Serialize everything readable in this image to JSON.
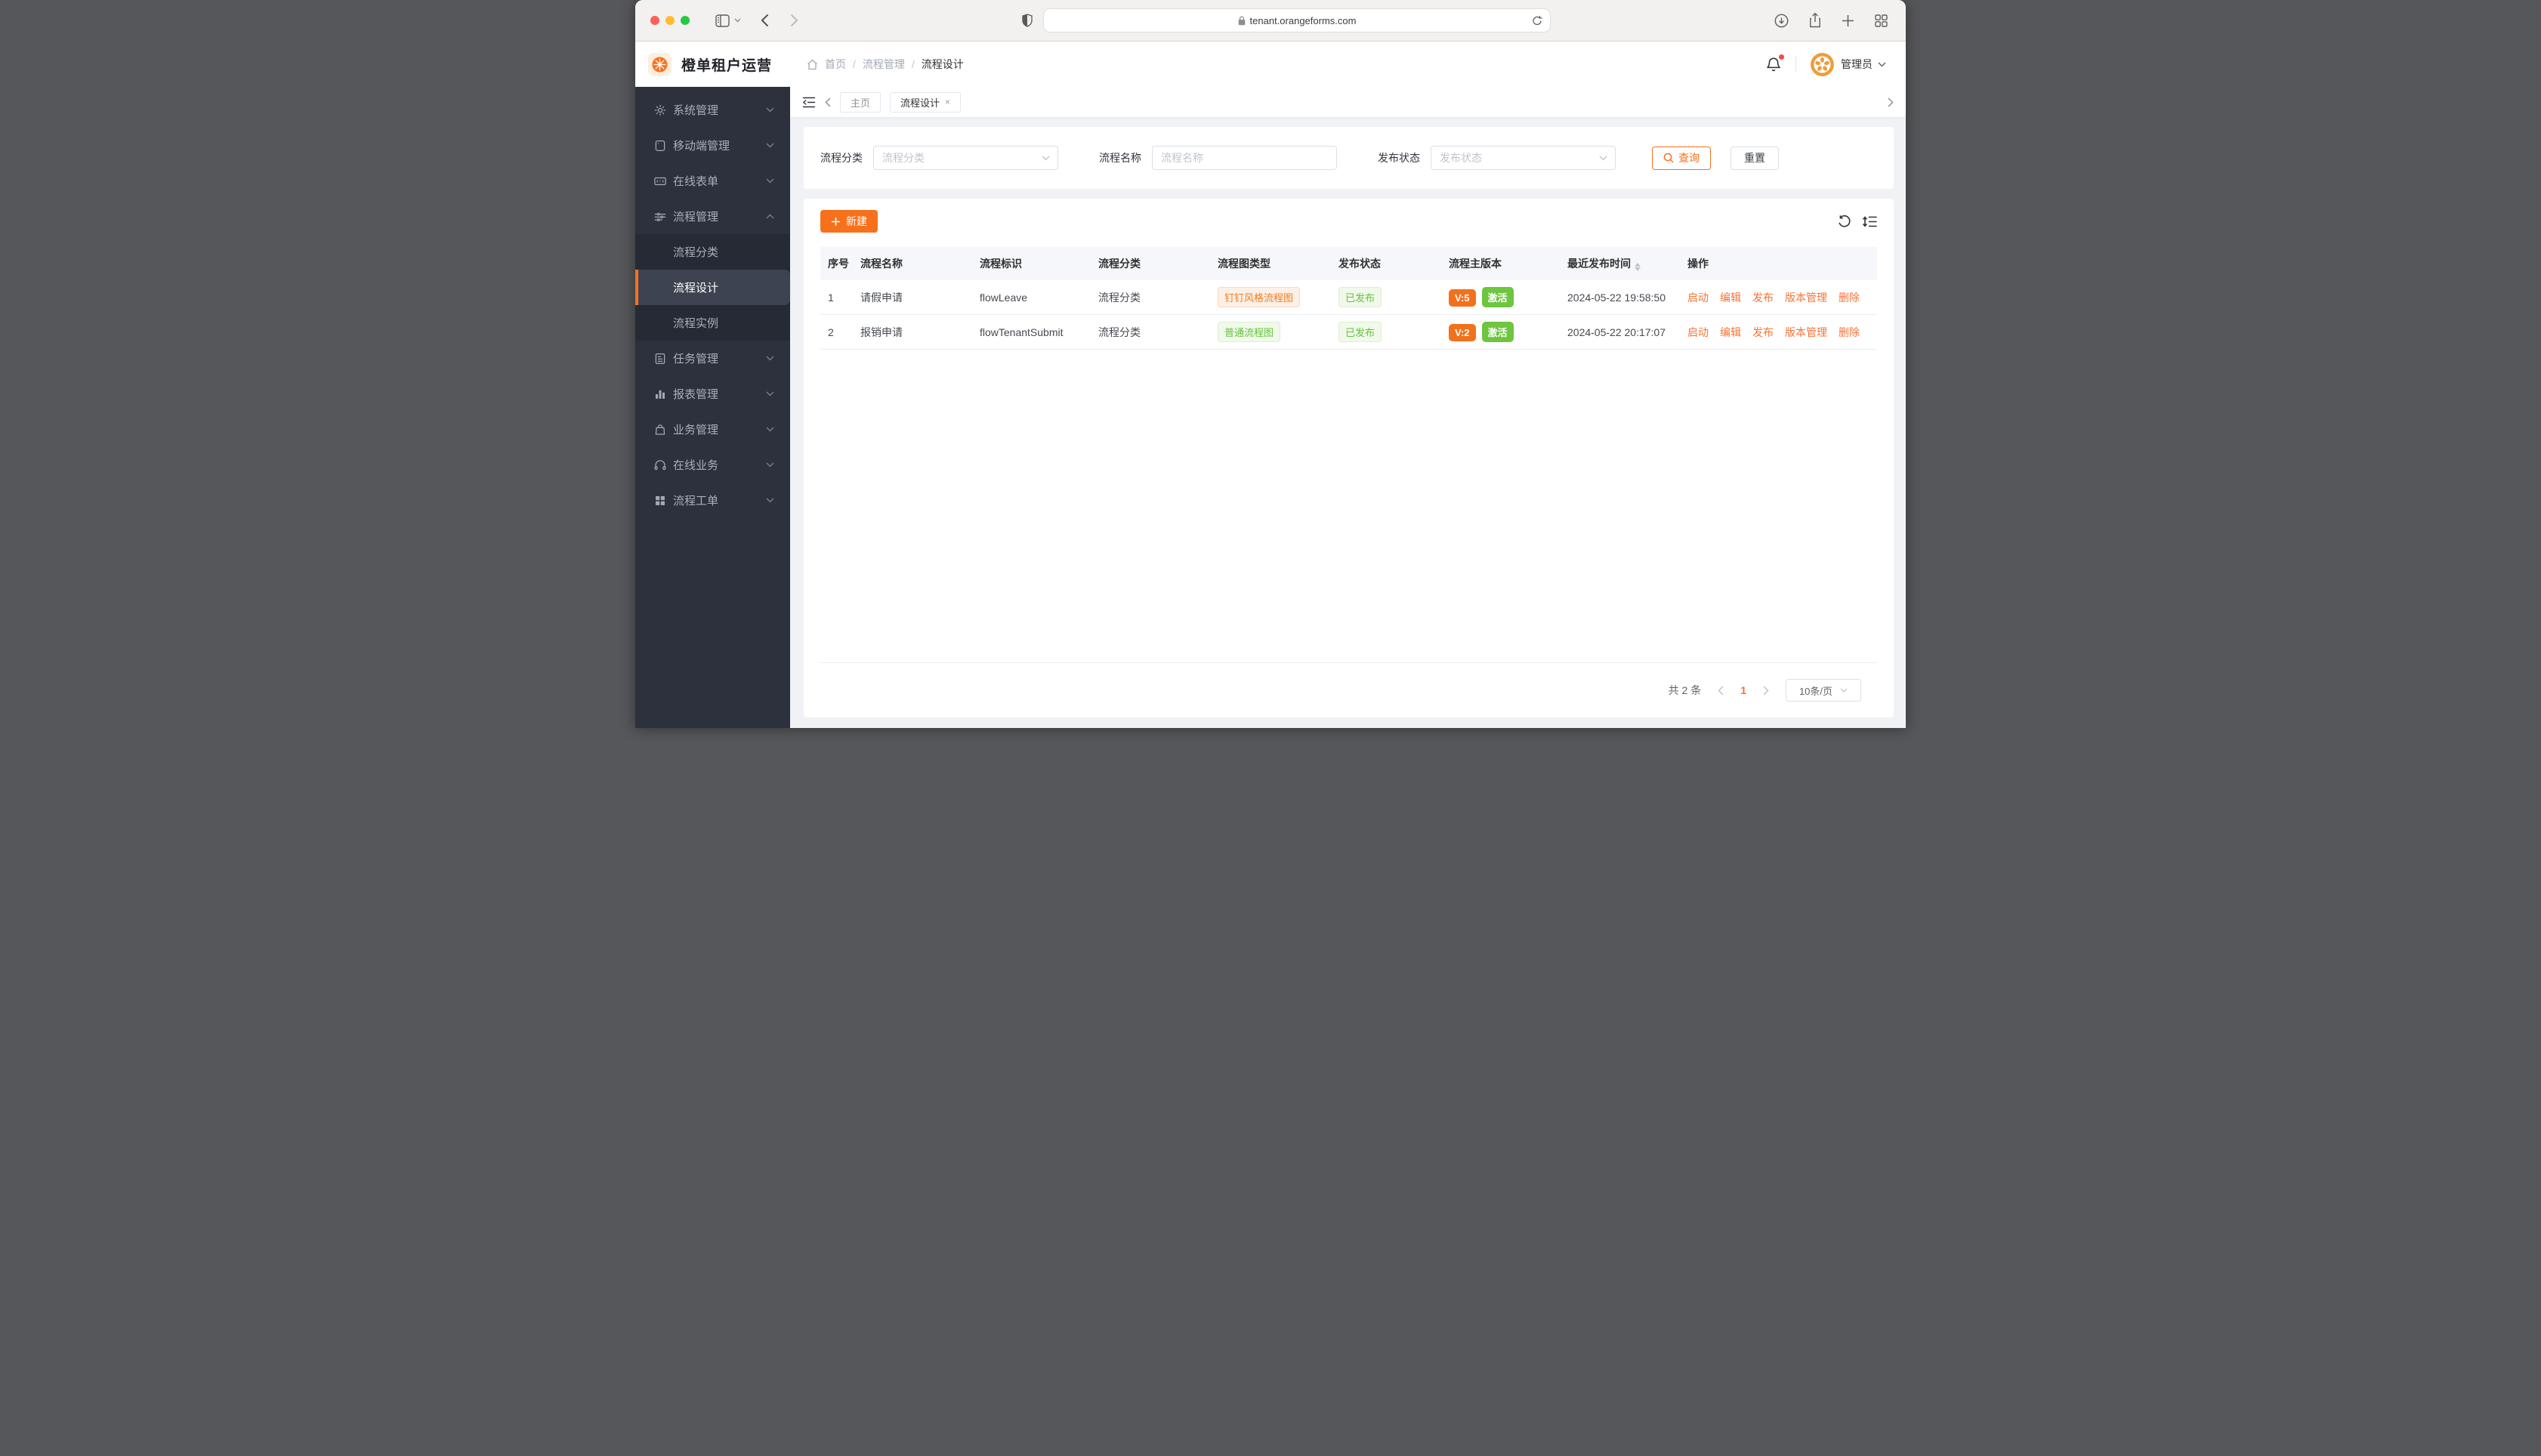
{
  "browser": {
    "url": "tenant.orangeforms.com"
  },
  "app_header": {
    "title": "橙单租户运营",
    "breadcrumb": {
      "home": "首页",
      "section": "流程管理",
      "current": "流程设计",
      "separator": "/"
    },
    "username": "管理员"
  },
  "sidebar": {
    "items": [
      {
        "label": "系统管理"
      },
      {
        "label": "移动端管理"
      },
      {
        "label": "在线表单"
      },
      {
        "label": "流程管理"
      },
      {
        "label": "任务管理"
      },
      {
        "label": "报表管理"
      },
      {
        "label": "业务管理"
      },
      {
        "label": "在线业务"
      },
      {
        "label": "流程工单"
      }
    ],
    "submenu": [
      {
        "label": "流程分类"
      },
      {
        "label": "流程设计"
      },
      {
        "label": "流程实例"
      }
    ]
  },
  "tabs": {
    "home": "主页",
    "active": "流程设计",
    "close": "×"
  },
  "filters": {
    "category_label": "流程分类",
    "category_placeholder": "流程分类",
    "name_label": "流程名称",
    "name_placeholder": "流程名称",
    "status_label": "发布状态",
    "status_placeholder": "发布状态",
    "search": "查询",
    "reset": "重置"
  },
  "toolbar": {
    "create": "新建"
  },
  "table": {
    "columns": [
      "序号",
      "流程名称",
      "流程标识",
      "流程分类",
      "流程图类型",
      "发布状态",
      "流程主版本",
      "最近发布时间",
      "操作"
    ],
    "rows": [
      {
        "index": "1",
        "name": "请假申请",
        "key": "flowLeave",
        "category": "流程分类",
        "diagram_type": "钉钉风格流程图",
        "diagram_variant": "orange",
        "status": "已发布",
        "version": "V:5",
        "version_state": "激活",
        "published_at": "2024-05-22 19:58:50"
      },
      {
        "index": "2",
        "name": "报销申请",
        "key": "flowTenantSubmit",
        "category": "流程分类",
        "diagram_type": "普通流程图",
        "diagram_variant": "green",
        "status": "已发布",
        "version": "V:2",
        "version_state": "激活",
        "published_at": "2024-05-22 20:17:07"
      }
    ],
    "actions": [
      "启动",
      "编辑",
      "发布",
      "版本管理",
      "删除"
    ]
  },
  "pagination": {
    "total": "共 2 条",
    "page": "1",
    "page_size": "10条/页"
  },
  "colors": {
    "primary": "#F7711D",
    "link": "#F77234",
    "success": "#67C23A",
    "success_badge": "#6EC53F",
    "sidebar_bg": "#2C313D",
    "submenu_bg": "#252A34",
    "active_item_bg": "#3D4350"
  }
}
